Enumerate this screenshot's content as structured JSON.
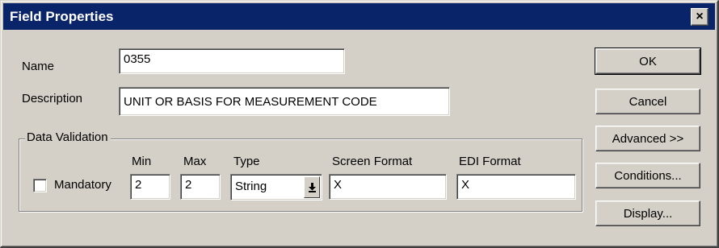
{
  "window": {
    "title": "Field Properties",
    "close_label": "×"
  },
  "form": {
    "name_label": "Name",
    "name_value": "0355",
    "description_label": "Description",
    "description_value": "UNIT OR BASIS FOR MEASUREMENT CODE"
  },
  "data_validation": {
    "group_label": "Data Validation",
    "mandatory_label": "Mandatory",
    "mandatory_checked": false,
    "min_label": "Min",
    "min_value": "2",
    "max_label": "Max",
    "max_value": "2",
    "type_label": "Type",
    "type_value": "String",
    "screen_format_label": "Screen Format",
    "screen_format_value": "X",
    "edi_format_label": "EDI Format",
    "edi_format_value": "X"
  },
  "buttons": {
    "ok": "OK",
    "cancel": "Cancel",
    "advanced": "Advanced >>",
    "conditions": "Conditions...",
    "display": "Display..."
  },
  "colors": {
    "titlebar": "#0a246a",
    "face": "#d4d0c8"
  }
}
